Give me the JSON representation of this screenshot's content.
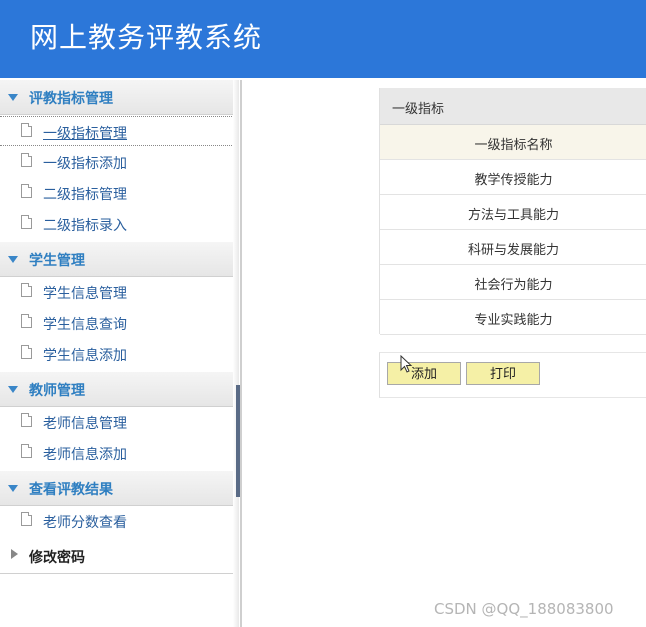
{
  "header": {
    "title": "网上教务评教系统"
  },
  "sidebar": {
    "groups": [
      {
        "label": "评教指标管理",
        "items": [
          {
            "label": "一级指标管理"
          },
          {
            "label": "一级指标添加"
          },
          {
            "label": "二级指标管理"
          },
          {
            "label": "二级指标录入"
          }
        ]
      },
      {
        "label": "学生管理",
        "items": [
          {
            "label": "学生信息管理"
          },
          {
            "label": "学生信息查询"
          },
          {
            "label": "学生信息添加"
          }
        ]
      },
      {
        "label": "教师管理",
        "items": [
          {
            "label": "老师信息管理"
          },
          {
            "label": "老师信息添加"
          }
        ]
      },
      {
        "label": "查看评教结果",
        "items": [
          {
            "label": "老师分数查看"
          }
        ]
      },
      {
        "label": "修改密码",
        "items": []
      }
    ]
  },
  "main": {
    "panel_title": "一级指标",
    "column_header": "一级指标名称",
    "rows": [
      "教学传授能力",
      "方法与工具能力",
      "科研与发展能力",
      "社会行为能力",
      "专业实践能力"
    ],
    "add_button": "添加",
    "print_button": "打印"
  },
  "watermark": "CSDN @QQ_188083800"
}
